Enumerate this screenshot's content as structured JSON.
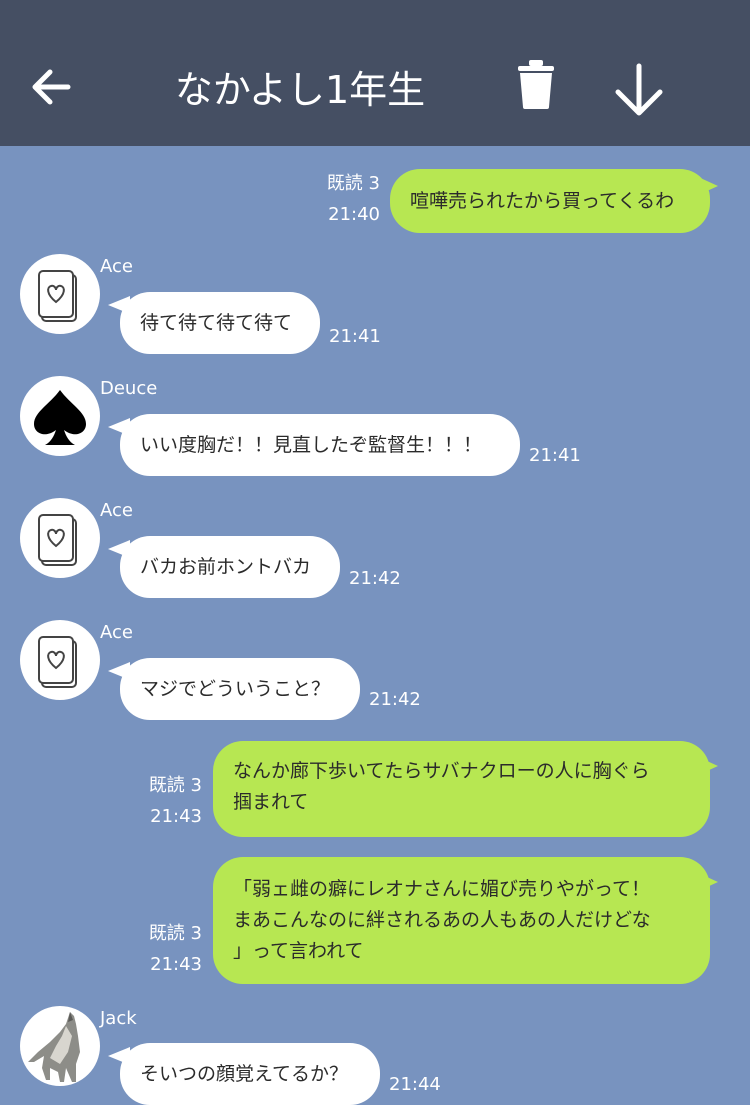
{
  "header": {
    "title": "なかよし1年生",
    "back_icon": "arrow-left-icon",
    "trash_icon": "trash-icon",
    "download_icon": "arrow-down-icon",
    "background": "#454f63"
  },
  "colors": {
    "chat_background": "#7893bf",
    "outgoing_bubble": "#b7e752",
    "incoming_bubble": "#ffffff"
  },
  "messages": [
    {
      "direction": "out",
      "lines": [
        "喧嘩売られたから買ってくるわ"
      ],
      "read": "既読 3",
      "time": "21:40"
    },
    {
      "direction": "in",
      "sender": "Ace",
      "avatar_icon": "heart-card-icon",
      "lines": [
        "待て待て待て待て"
      ],
      "time": "21:41"
    },
    {
      "direction": "in",
      "sender": "Deuce",
      "avatar_icon": "spade-icon",
      "lines": [
        "いい度胸だ！！見直したぞ監督生！！！"
      ],
      "time": "21:41"
    },
    {
      "direction": "in",
      "sender": "Ace",
      "avatar_icon": "heart-card-icon",
      "lines": [
        "バカお前ホントバカ"
      ],
      "time": "21:42"
    },
    {
      "direction": "in",
      "sender": "Ace",
      "avatar_icon": "heart-card-icon",
      "lines": [
        "マジでどういうこと？"
      ],
      "time": "21:42"
    },
    {
      "direction": "out",
      "lines": [
        "なんか廊下歩いてたらサバナクローの人に胸ぐら",
        "掴まれて"
      ],
      "read": "既読 3",
      "time": "21:43"
    },
    {
      "direction": "out",
      "lines": [
        "「弱ェ雌の癖にレオナさんに媚び売りやがって！",
        "まあこんなのに絆されるあの人もあの人だけどな",
        "」って言われて"
      ],
      "read": "既読 3",
      "time": "21:43"
    },
    {
      "direction": "in",
      "sender": "Jack",
      "avatar_icon": "wolf-icon",
      "lines": [
        "そいつの顔覚えてるか？"
      ],
      "time": "21:44"
    }
  ]
}
